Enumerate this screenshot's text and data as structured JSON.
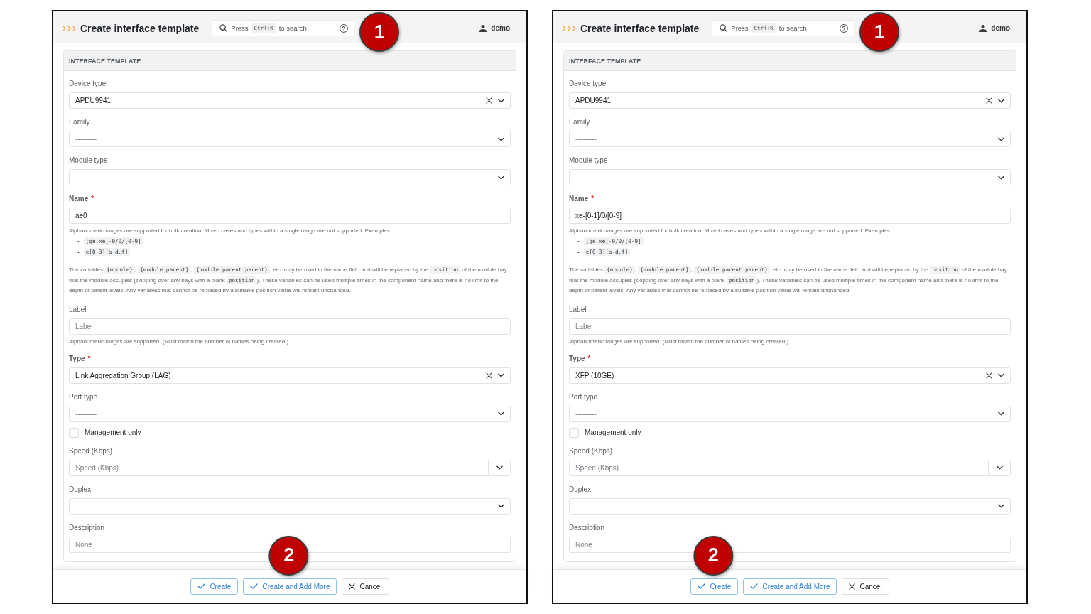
{
  "panels": [
    {
      "header": {
        "title": "Create interface template",
        "search": {
          "hint_before": "Press",
          "shortcut": "Ctrl+K",
          "hint_after": "to search",
          "marker": "1"
        },
        "user": "demo"
      },
      "section": {
        "title": "INTERFACE TEMPLATE",
        "fields": [
          {
            "kind": "select",
            "label": "Device type",
            "value": "APDU9941"
          },
          {
            "kind": "select",
            "label": "Family",
            "placeholder": "---------"
          },
          {
            "kind": "select",
            "label": "Module type",
            "placeholder": "---------"
          },
          {
            "kind": "text",
            "label": "Name",
            "required_mark": "*",
            "value": "ae0",
            "help": "Alphanumeric ranges are supported for bulk creation. Mixed cases and types within a single range are not supported. Examples:",
            "examples": [
              {
                "marker": "•",
                "code": "[ge,xe]-0/0/[0-9]"
              },
              {
                "marker": "•",
                "code": "e[0-3][a-d,f]"
              }
            ],
            "note_parts": [
              {
                "kind": "text",
                "text": "The variables "
              },
              {
                "kind": "code",
                "text": "{module}"
              },
              {
                "kind": "text",
                "text": ", "
              },
              {
                "kind": "code",
                "text": "{module.parent}"
              },
              {
                "kind": "text",
                "text": ", "
              },
              {
                "kind": "code",
                "text": "{module.parent.parent}"
              },
              {
                "kind": "text",
                "text": ", etc. may be used in the name field and will be replaced by the "
              },
              {
                "kind": "code",
                "text": "position"
              },
              {
                "kind": "text",
                "text": " of the module bay that the module occupies (skipping over any bays with a blank "
              },
              {
                "kind": "code",
                "text": "position"
              },
              {
                "kind": "text",
                "text": "). These variables can be used multiple times in the component name and there is no limit to the depth of parent levels. Any variables that cannot be replaced by a suitable position value will remain unchanged."
              }
            ]
          },
          {
            "kind": "text",
            "label": "Label",
            "placeholder": "Label",
            "help": "Alphanumeric ranges are supported. (Must match the number of names being created.)"
          },
          {
            "kind": "select",
            "label": "Type",
            "required_mark": "*",
            "value": "Link Aggregation Group (LAG)"
          },
          {
            "kind": "select",
            "label": "Port type",
            "placeholder": "---------"
          },
          {
            "kind": "checkbox",
            "label": "Management only",
            "checked": false
          },
          {
            "kind": "addon",
            "label": "Speed (Kbps)",
            "placeholder": "Speed (Kbps)"
          },
          {
            "kind": "select",
            "label": "Duplex",
            "placeholder": "---------"
          },
          {
            "kind": "text",
            "label": "Description",
            "placeholder": "None"
          }
        ]
      },
      "buttons": [
        {
          "kind": "confirm",
          "label": "Create"
        },
        {
          "kind": "confirm",
          "label": "Create and Add More",
          "marker": "2"
        },
        {
          "kind": "cancel",
          "label": "Cancel"
        }
      ]
    },
    {
      "header": {
        "title": "Create interface template",
        "search": {
          "hint_before": "Press",
          "shortcut": "Ctrl+K",
          "hint_after": "to search",
          "marker": "1"
        },
        "user": "demo"
      },
      "section": {
        "title": "INTERFACE TEMPLATE",
        "fields": [
          {
            "kind": "select",
            "label": "Device type",
            "value": "APDU9941"
          },
          {
            "kind": "select",
            "label": "Family",
            "placeholder": "---------"
          },
          {
            "kind": "select",
            "label": "Module type",
            "placeholder": "---------"
          },
          {
            "kind": "text",
            "label": "Name",
            "required_mark": "*",
            "value": "xe-[0-1]/0/[0-9]",
            "help": "Alphanumeric ranges are supported for bulk creation. Mixed cases and types within a single range are not supported. Examples:",
            "examples": [
              {
                "marker": "•",
                "code": "[ge,xe]-0/0/[0-9]"
              },
              {
                "marker": "•",
                "code": "e[0-3][a-d,f]"
              }
            ],
            "note_parts": [
              {
                "kind": "text",
                "text": "The variables "
              },
              {
                "kind": "code",
                "text": "{module}"
              },
              {
                "kind": "text",
                "text": ", "
              },
              {
                "kind": "code",
                "text": "{module.parent}"
              },
              {
                "kind": "text",
                "text": ", "
              },
              {
                "kind": "code",
                "text": "{module.parent.parent}"
              },
              {
                "kind": "text",
                "text": ", etc. may be used in the name field and will be replaced by the "
              },
              {
                "kind": "code",
                "text": "position"
              },
              {
                "kind": "text",
                "text": " of the module bay that the module occupies (skipping over any bays with a blank "
              },
              {
                "kind": "code",
                "text": "position"
              },
              {
                "kind": "text",
                "text": "). These variables can be used multiple times in the component name and there is no limit to the depth of parent levels. Any variables that cannot be replaced by a suitable position value will remain unchanged."
              }
            ]
          },
          {
            "kind": "text",
            "label": "Label",
            "placeholder": "Label",
            "help": "Alphanumeric ranges are supported. (Must match the number of names being created.)"
          },
          {
            "kind": "select",
            "label": "Type",
            "required_mark": "*",
            "value": "XFP (10GE)"
          },
          {
            "kind": "select",
            "label": "Port type",
            "placeholder": "---------"
          },
          {
            "kind": "checkbox",
            "label": "Management only",
            "checked": false
          },
          {
            "kind": "addon",
            "label": "Speed (Kbps)",
            "placeholder": "Speed (Kbps)"
          },
          {
            "kind": "select",
            "label": "Duplex",
            "placeholder": "---------"
          },
          {
            "kind": "text",
            "label": "Description",
            "placeholder": "None"
          }
        ]
      },
      "buttons": [
        {
          "kind": "confirm",
          "label": "Create",
          "marker": "2"
        },
        {
          "kind": "confirm",
          "label": "Create and Add More"
        },
        {
          "kind": "cancel",
          "label": "Cancel"
        }
      ]
    }
  ]
}
